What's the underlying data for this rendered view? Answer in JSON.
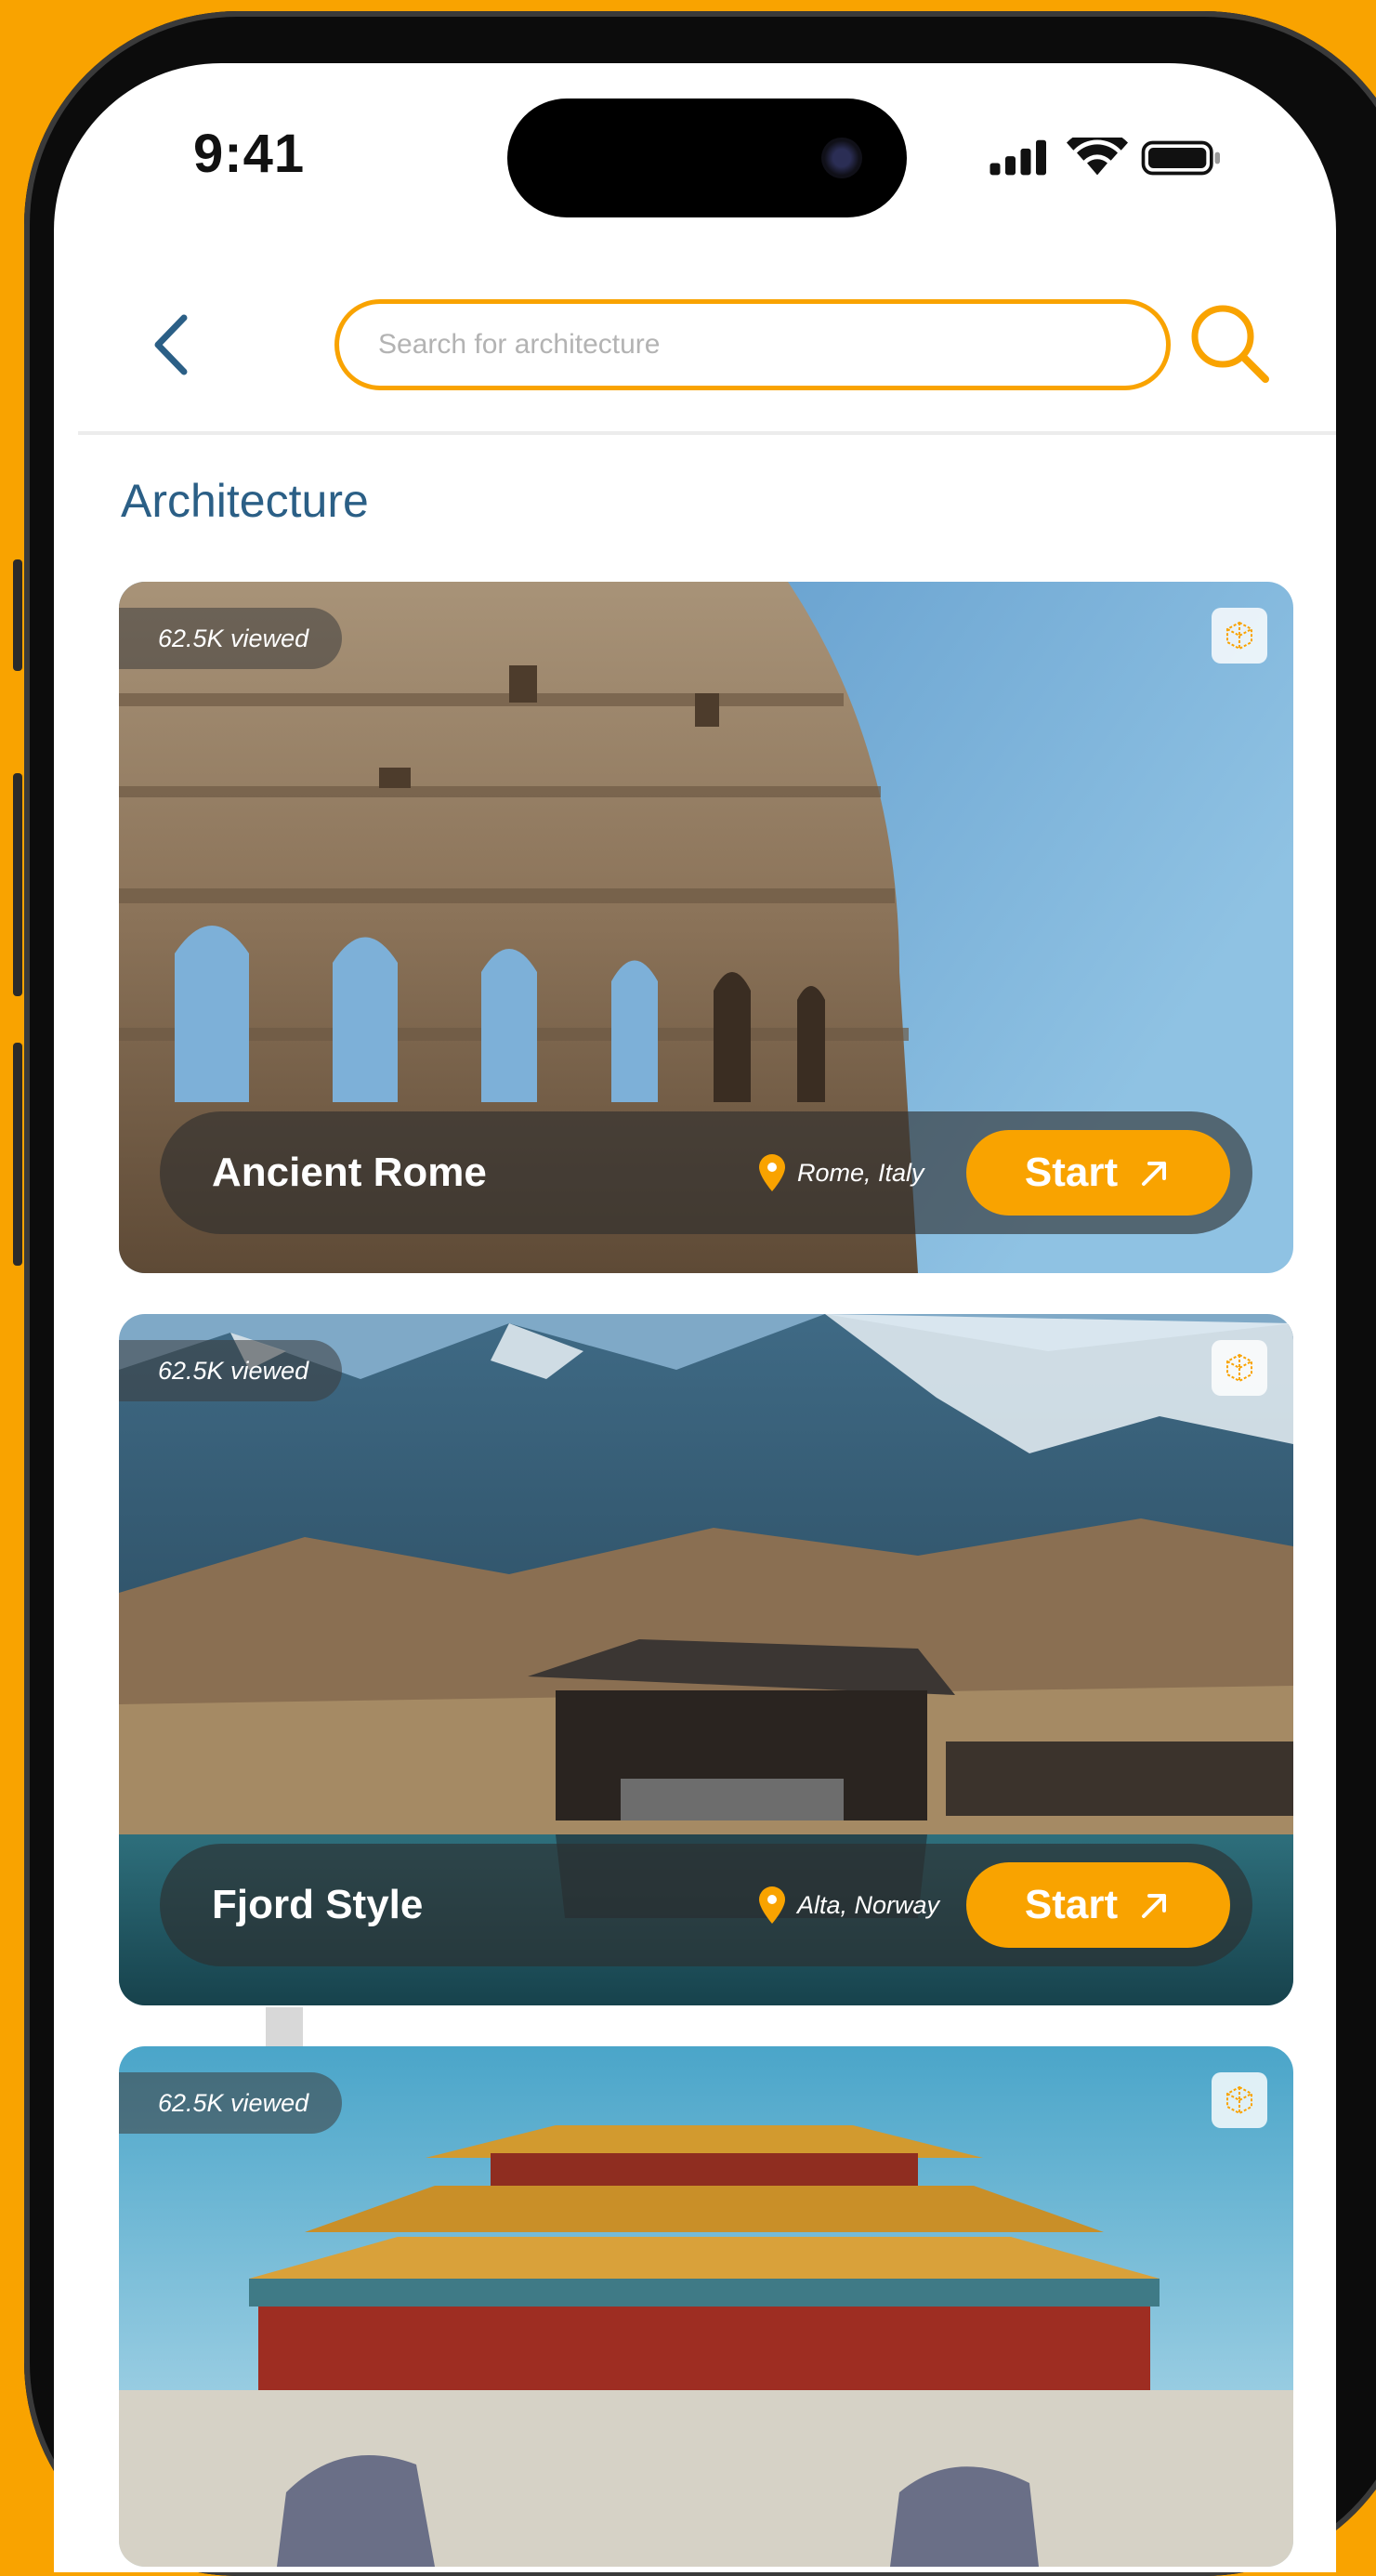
{
  "status_bar": {
    "time": "9:41"
  },
  "header": {
    "search_placeholder": "Search for architecture",
    "back_icon": "chevron-left-icon",
    "search_icon": "magnifier-icon"
  },
  "page": {
    "section_title": "Architecture"
  },
  "cards": [
    {
      "title": "Ancient Rome",
      "location": "Rome, Italy",
      "views": "62.5K viewed",
      "button": "Start"
    },
    {
      "title": "Fjord Style",
      "location": "Alta, Norway",
      "views": "62.5K viewed",
      "button": "Start"
    },
    {
      "title": "",
      "location": "",
      "views": "62.5K viewed",
      "button": ""
    }
  ],
  "colors": {
    "accent": "#F9A300",
    "title_blue": "#2B5F86",
    "back_blue": "#2B5F86"
  }
}
